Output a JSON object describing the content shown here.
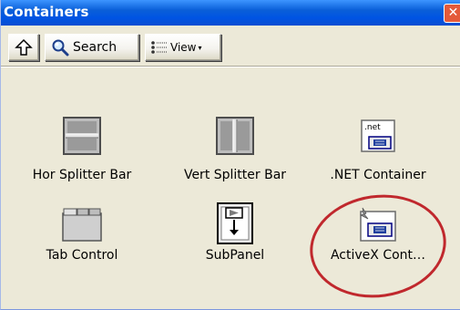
{
  "window": {
    "title": "Containers",
    "close_glyph": "✕"
  },
  "toolbar": {
    "up_icon": "up-arrow-icon",
    "search_label": "Search",
    "view_label": "View",
    "view_caret": "▾"
  },
  "items": [
    {
      "label": "Hor Splitter Bar",
      "icon": "horizontal-splitter-icon"
    },
    {
      "label": "Vert Splitter Bar",
      "icon": "vertical-splitter-icon"
    },
    {
      "label": ".NET Container",
      "icon": "net-container-icon",
      "icon_text": ".net"
    },
    {
      "label": "Tab Control",
      "icon": "tab-control-icon"
    },
    {
      "label": "SubPanel",
      "icon": "subpanel-icon"
    },
    {
      "label": "ActiveX Cont…",
      "icon": "activex-container-icon"
    }
  ],
  "colors": {
    "title_bar": "#0054e3",
    "window_bg": "#ece9d8",
    "annotation": "#c0282d"
  }
}
